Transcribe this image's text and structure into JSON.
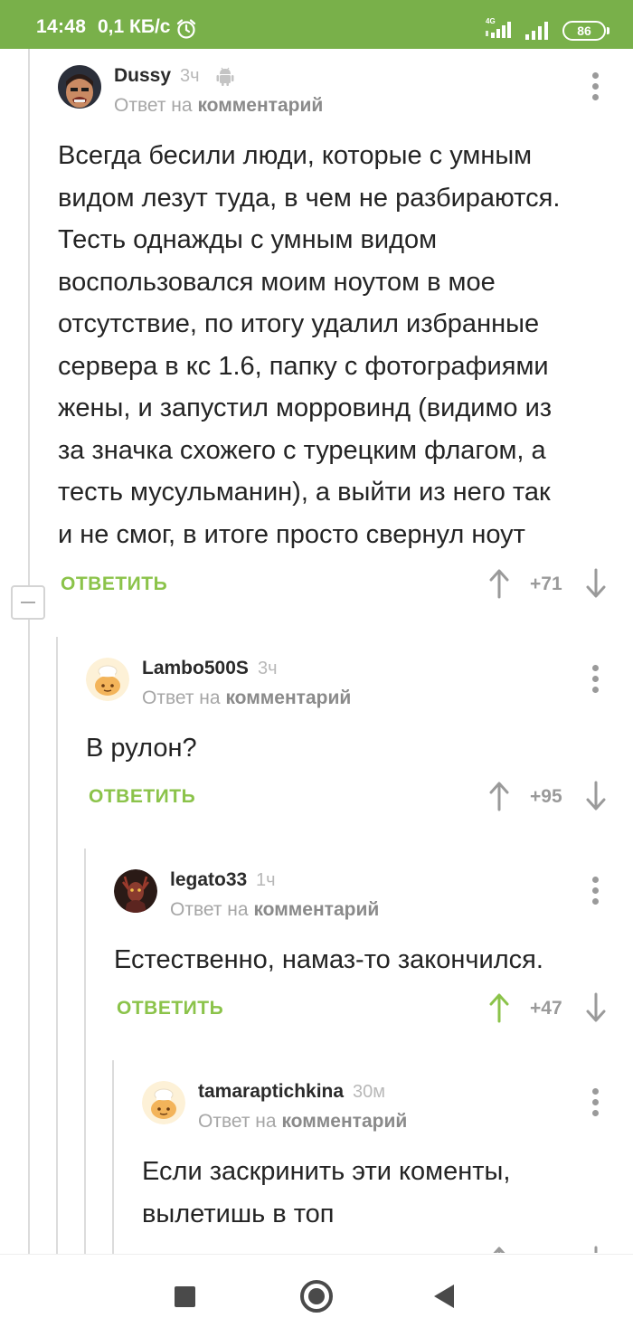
{
  "status_bar": {
    "time": "14:48",
    "speed": "0,1 КБ/с",
    "network": "4G",
    "battery": "86"
  },
  "labels": {
    "reply_prefix": "Ответ на",
    "reply_target": "комментарий",
    "reply_button": "ОТВЕТИТЬ"
  },
  "comments": [
    {
      "author": "Dussy",
      "time": "3ч",
      "platform_icon": "android-icon",
      "lines": [
        "Всегда бесили люди, которые с умным",
        "видом лезут туда, в чем не разбираются.",
        "Тесть однажды с умным видом",
        "воспользовался моим ноутом в мое",
        "отсутствие, по итогу удалил избранные",
        "сервера в кс 1.6, папку с фотографиями",
        "жены, и запустил морровинд (видимо из",
        "за значка схожего с турецким флагом, а",
        "тесть мусульманин), а выйти из него так",
        "и не смог, в итоге просто свернул ноут"
      ],
      "rating": "+71",
      "voted_up": false
    },
    {
      "author": "Lambo500S",
      "time": "3ч",
      "lines": [
        "В рулон?"
      ],
      "rating": "+95",
      "voted_up": false
    },
    {
      "author": "legato33",
      "time": "1ч",
      "lines": [
        "Естественно, намаз-то закончился."
      ],
      "rating": "+47",
      "voted_up": true
    },
    {
      "author": "tamaraptichkina",
      "time": "30м",
      "lines": [
        "Если заскринить эти коменты,",
        "вылетишь в топ"
      ],
      "rating": "",
      "voted_up": false
    }
  ],
  "colors": {
    "status_bar": "#79b04a",
    "accent": "#8bc34a",
    "upvoted": "#8bc34a"
  }
}
